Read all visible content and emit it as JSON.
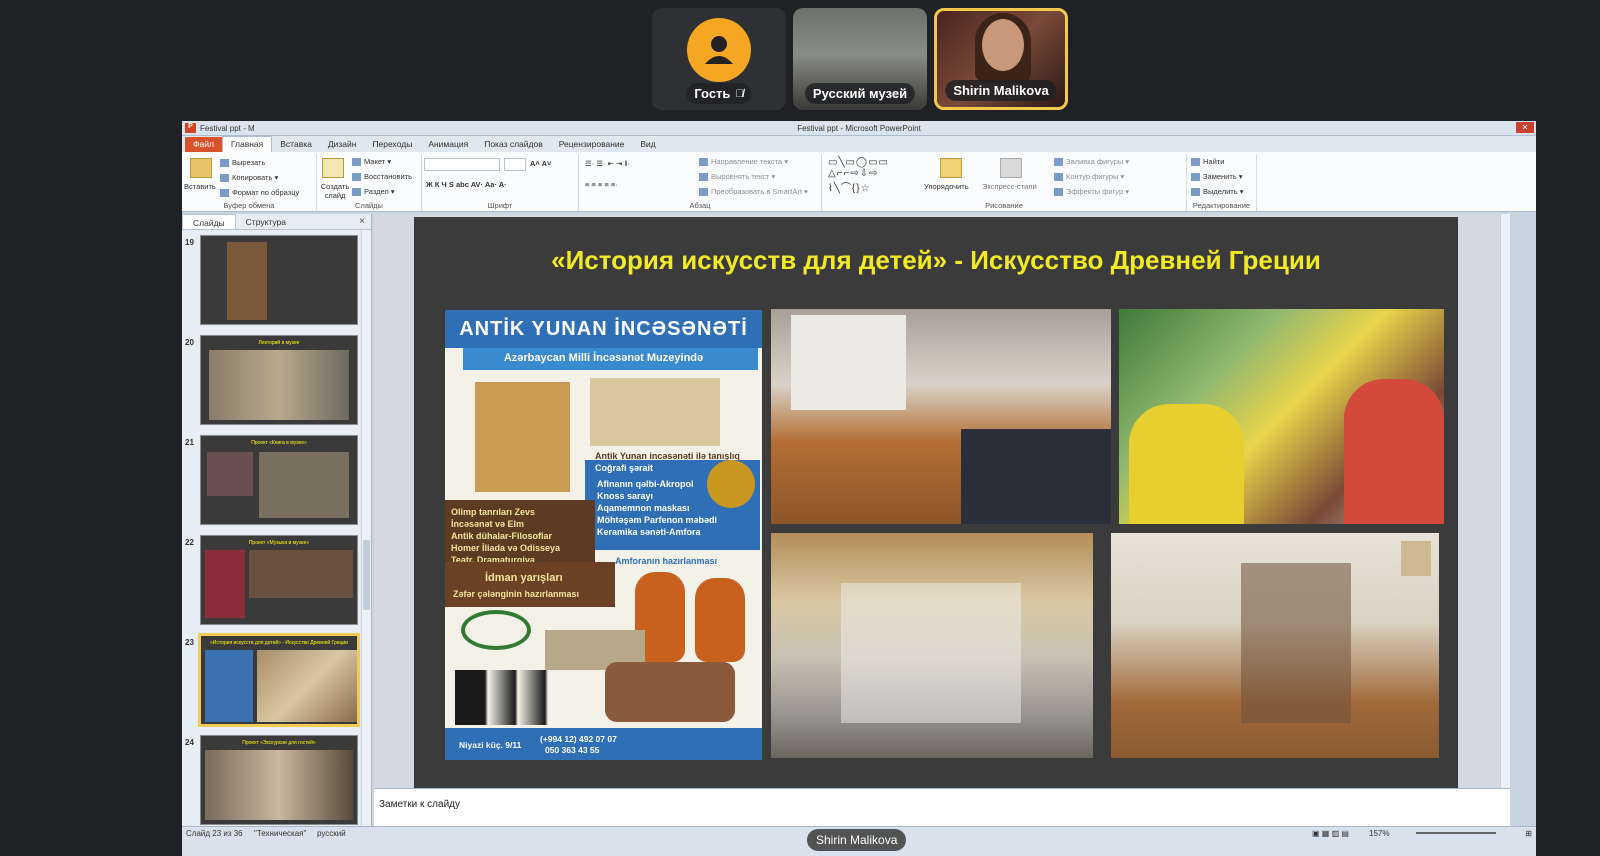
{
  "participants": [
    {
      "name": "Гость",
      "muted": true
    },
    {
      "name": "Русский музей"
    },
    {
      "name": "Shirin Malikova",
      "active": true
    }
  ],
  "window": {
    "title": "Festival ppt - Microsoft PowerPoint",
    "left_title": "Festival ppt - M"
  },
  "tabs": [
    "Файл",
    "Главная",
    "Вставка",
    "Дизайн",
    "Переходы",
    "Анимация",
    "Показ слайдов",
    "Рецензирование",
    "Вид"
  ],
  "ribbon": {
    "clipboard": {
      "paste": "Вставить",
      "cut": "Вырезать",
      "copy": "Копировать",
      "format": "Формат по образцу",
      "label": "Буфер обмена"
    },
    "slides": {
      "new": "Создать слайд",
      "layout": "Макет",
      "reset": "Восстановить",
      "section": "Раздел",
      "label": "Слайды"
    },
    "font": {
      "label": "Шрифт"
    },
    "paragraph": {
      "text_dir": "Направление текста",
      "align": "Выровнять текст",
      "smartart": "Преобразовать в SmartArt",
      "label": "Абзац"
    },
    "drawing": {
      "arrange": "Упорядочить",
      "styles": "Экспресс-стили",
      "fill": "Заливка фигуры",
      "outline": "Контур фигуры",
      "effects": "Эффекты фигур",
      "label": "Рисование"
    },
    "editing": {
      "find": "Найти",
      "replace": "Заменить",
      "select": "Выделить",
      "label": "Редактирование"
    }
  },
  "pane": {
    "tab_slides": "Слайды",
    "tab_outline": "Структура",
    "close": "×",
    "thumbs": [
      {
        "num": "19",
        "title": ""
      },
      {
        "num": "20",
        "title": "Лекторий в музее"
      },
      {
        "num": "21",
        "title": "Проект «Книга в музее»"
      },
      {
        "num": "22",
        "title": "Проект «Музыка в музее»"
      },
      {
        "num": "23",
        "title": "«История искусств для детей» - Искусство Древней Греции",
        "selected": true
      },
      {
        "num": "24",
        "title": "Проект «Экскурсии для гостей»"
      }
    ]
  },
  "slide": {
    "title": "«История искусств для детей» - Искусство Древней Греции",
    "poster": {
      "title": "ANTİK YUNAN İNCƏSƏNƏTİ",
      "subtitle": "Azərbaycan Milli İncəsənət Muzeyində",
      "intro": "Antik Yunan incəsənəti ilə tanışlıq",
      "geo": "Coğrafi şərait",
      "blue_lines": [
        "Afinanın qəlbi-Akropol",
        "Knoss sarayı",
        "Aqamemnon maskası",
        "Möhtəşəm Parfenon məbədi",
        "Keramika sənəti-Amfora"
      ],
      "left_lines": [
        "Olimp tanrıları Zevs",
        "İncəsənət və Elm",
        "Antik dühalar-Filosoflar",
        "Homer İliada və Odisseya",
        "Teatr. Dramaturgiya"
      ],
      "amphora": "Amforanın hazırlanması",
      "sport": "İdman yarışları",
      "wreath": "Zəfər çələnginin hazırlanması",
      "footer_addr": "Niyazi küç. 9/11",
      "phone1": "(+994 12) 492 07 07",
      "phone2": "050 363 43 55"
    }
  },
  "notes": "Заметки к слайду",
  "status": {
    "slide": "Слайд 23 из 36",
    "theme": "\"Техническая\"",
    "lang": "русский",
    "zoom": "157%"
  },
  "presenter": "Shirin Malikova"
}
